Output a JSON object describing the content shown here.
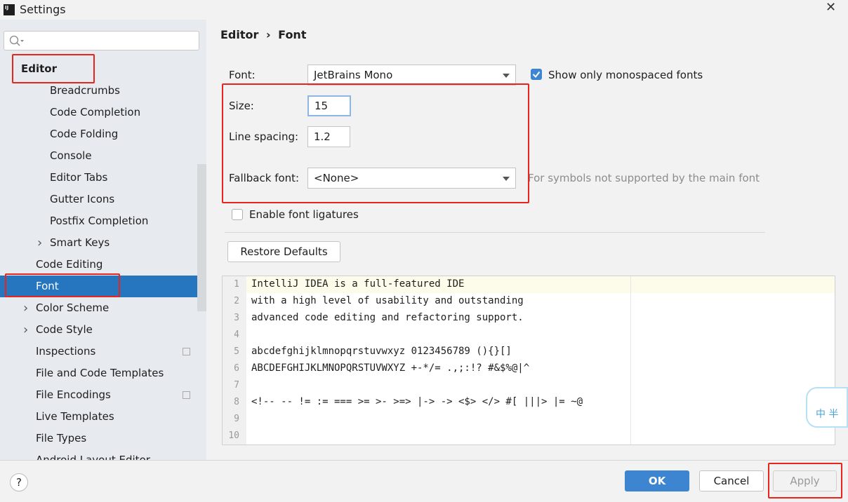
{
  "window": {
    "title": "Settings",
    "logo": "IJ",
    "close_icon": "close-icon"
  },
  "sidebar": {
    "search_placeholder": "",
    "items": [
      {
        "label": "Editor",
        "level": 0,
        "bold": true
      },
      {
        "label": "Breadcrumbs",
        "level": 2
      },
      {
        "label": "Code Completion",
        "level": 2
      },
      {
        "label": "Code Folding",
        "level": 2
      },
      {
        "label": "Console",
        "level": 2
      },
      {
        "label": "Editor Tabs",
        "level": 2
      },
      {
        "label": "Gutter Icons",
        "level": 2
      },
      {
        "label": "Postfix Completion",
        "level": 2
      },
      {
        "label": "Smart Keys",
        "level": 2,
        "expandable": true
      },
      {
        "label": "Code Editing",
        "level": 1
      },
      {
        "label": "Font",
        "level": 1,
        "selected": true
      },
      {
        "label": "Color Scheme",
        "level": 1,
        "expandable": true
      },
      {
        "label": "Code Style",
        "level": 1,
        "expandable": true
      },
      {
        "label": "Inspections",
        "level": 1,
        "project_icon": true
      },
      {
        "label": "File and Code Templates",
        "level": 1
      },
      {
        "label": "File Encodings",
        "level": 1,
        "project_icon": true
      },
      {
        "label": "Live Templates",
        "level": 1
      },
      {
        "label": "File Types",
        "level": 1
      },
      {
        "label": "Android Layout Editor",
        "level": 1
      }
    ]
  },
  "breadcrumb": {
    "parent": "Editor",
    "separator": "›",
    "current": "Font"
  },
  "form": {
    "font_label": "Font:",
    "font_value": "JetBrains Mono",
    "mono_label": "Show only monospaced fonts",
    "mono_checked": true,
    "size_label": "Size:",
    "size_value": "15",
    "spacing_label": "Line spacing:",
    "spacing_value": "1.2",
    "fallback_label": "Fallback font:",
    "fallback_value": "<None>",
    "fallback_hint": "For symbols not supported by the main font",
    "ligatures_label": "Enable font ligatures",
    "ligatures_checked": false,
    "restore_label": "Restore Defaults"
  },
  "preview": {
    "lines": [
      "IntelliJ IDEA is a full-featured IDE",
      "with a high level of usability and outstanding",
      "advanced code editing and refactoring support.",
      "",
      "abcdefghijklmnopqrstuvwxyz 0123456789 (){}[]",
      "ABCDEFGHIJKLMNOPQRSTUVWXYZ +-*/= .,;:!? #&$%@|^",
      "",
      "<!-- -- != := === >= >- >=> |-> -> <$> </> #[ |||> |= ~@",
      "",
      ""
    ],
    "line_numbers": [
      "1",
      "2",
      "3",
      "4",
      "5",
      "6",
      "7",
      "8",
      "9",
      "10"
    ]
  },
  "footer": {
    "help": "?",
    "ok": "OK",
    "cancel": "Cancel",
    "apply": "Apply"
  },
  "widget": {
    "text": "中 半"
  },
  "colors": {
    "accent": "#2675bf",
    "highlight": "#e8241c",
    "ok_button": "#3d85d1"
  }
}
